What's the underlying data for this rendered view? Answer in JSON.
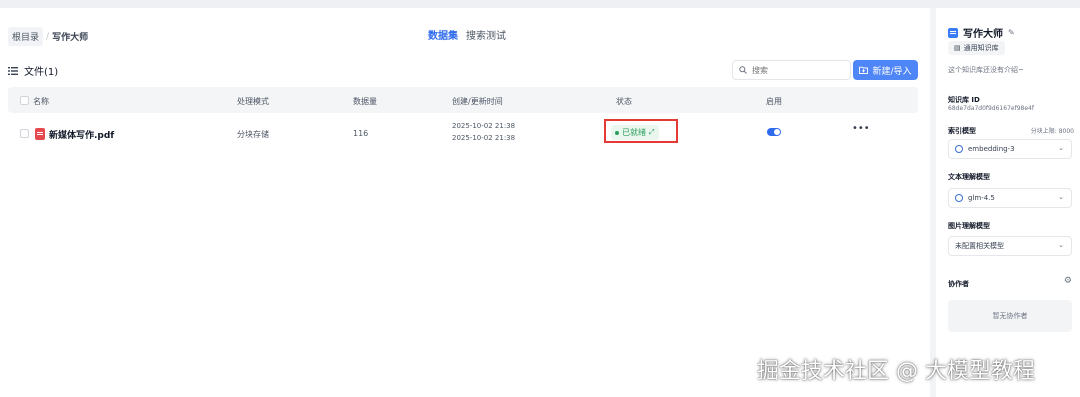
{
  "breadcrumb": {
    "root": "根目录",
    "current": "写作大师"
  },
  "tabs": [
    {
      "label": "数据集"
    },
    {
      "label": "搜索测试"
    }
  ],
  "files": {
    "title": "文件(1)"
  },
  "search": {
    "placeholder": "搜索"
  },
  "toolbar": {
    "new_label": "新建/导入"
  },
  "table": {
    "headers": [
      "名称",
      "处理模式",
      "数据量",
      "创建/更新时间",
      "状态",
      "启用"
    ],
    "rows": [
      {
        "name": "新媒体写作.pdf",
        "mode": "分块存储",
        "count": "116",
        "created": "2025-10-02 21:38",
        "updated": "2025-10-02 21:38",
        "status": "已就绪",
        "enabled": true
      }
    ]
  },
  "sidebar": {
    "title": "写作大师",
    "kb_type": "通用知识库",
    "description": "这个知识库还没有介绍~",
    "kb_id_label": "知识库 ID",
    "kb_id": "68de7da7d0f9d6167ef98e4f",
    "index_model_label": "索引模型",
    "chunk_limit": "分块上限: 8000",
    "index_model": "embedding-3",
    "text_model_label": "文本理解模型",
    "text_model": "glm-4.5",
    "image_model_label": "图片理解模型",
    "image_model": "未配置相关模型",
    "collaborators_label": "协作者",
    "no_collaborators": "暂无协作者"
  },
  "watermark": "掘金技术社区 @ 大模型教程",
  "colors": {
    "accent": "#2f6bed",
    "button": "#4f86f7",
    "status_green": "#2a9d5a",
    "highlight_red": "#e53935"
  }
}
